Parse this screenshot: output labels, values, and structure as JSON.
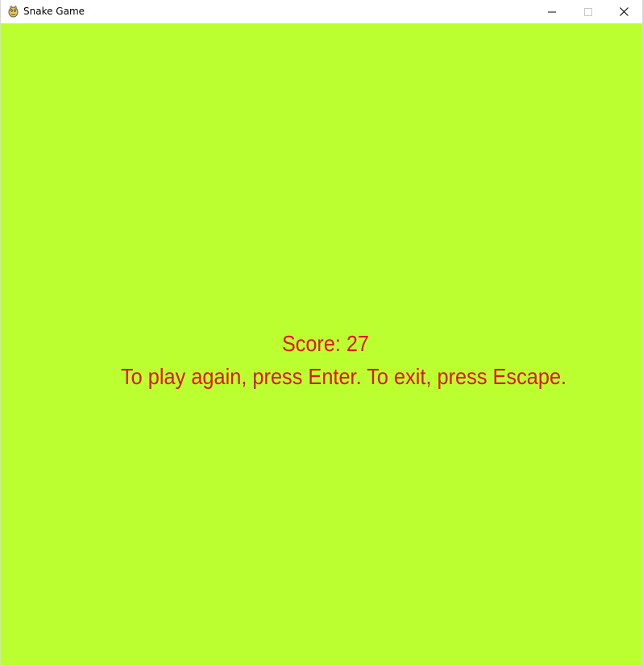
{
  "window": {
    "title": "Snake Game",
    "icon": "pygame-snake-icon",
    "controls": [
      "minimize-icon",
      "maximize-icon",
      "close-icon"
    ]
  },
  "game": {
    "background_color": "#bbff31",
    "text_color": "#e31515",
    "score_text": "Score: 27",
    "instruction_text": "To play again, press Enter. To exit, press Escape."
  }
}
